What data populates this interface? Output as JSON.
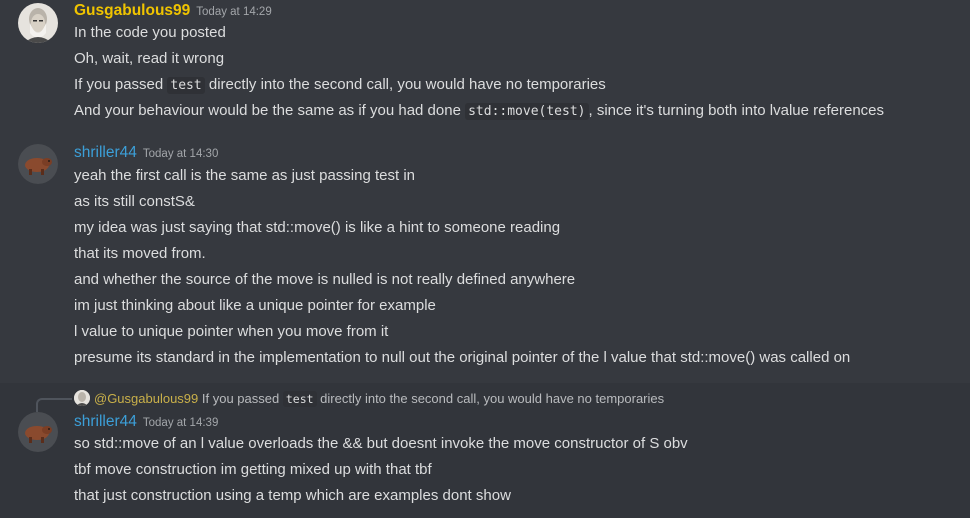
{
  "messages": [
    {
      "username": "Gusgabulous99",
      "timestamp": "Today at 14:29",
      "lines": [
        {
          "text": "In the code you posted"
        },
        {
          "text": "Oh, wait, read it wrong"
        },
        {
          "pre": "If you passed ",
          "code": "test",
          "post": " directly into the second call, you would have no temporaries"
        },
        {
          "pre": "And your behaviour would be the same as if you had done ",
          "code": "std::move(test)",
          "post": ", since it's turning both into lvalue references"
        }
      ]
    },
    {
      "username": "shriller44",
      "timestamp": "Today at 14:30",
      "lines": [
        {
          "text": "yeah the first call is the same as just passing test in"
        },
        {
          "text": "as its still constS&"
        },
        {
          "text": "my idea was just saying that std::move() is like a hint to someone reading"
        },
        {
          "text": "that its moved from."
        },
        {
          "text": "and whether the source of the move is nulled is not really defined anywhere"
        },
        {
          "text": "im just thinking about like a unique pointer for example"
        },
        {
          "text": "l value to unique pointer when you move from it"
        },
        {
          "text": "presume its standard in the implementation to null out the original pointer of the l value that std::move() was called on"
        }
      ]
    },
    {
      "reply": {
        "mention": "@Gusgabulous99",
        "pre": " If you passed ",
        "code": "test",
        "post": " directly into the second call, you would have no temporaries"
      },
      "username": "shriller44",
      "timestamp": "Today at 14:39",
      "lines": [
        {
          "text": "so std::move of an l value overloads the && but doesnt invoke the move constructor of S obv"
        },
        {
          "text": "tbf move construction im getting mixed up with that tbf"
        },
        {
          "text": "that just construction using a temp which are examples dont show"
        }
      ]
    }
  ],
  "colors": {
    "background": "#36393f",
    "hover_background": "#32353b",
    "gus_username": "#f0c400",
    "shriller_username": "#3c9fd8",
    "text": "#dcddde",
    "timestamp": "#a3a6aa"
  },
  "icons": [
    "avatar-old-man-photo",
    "avatar-capybara",
    "reply-spine-icon"
  ]
}
